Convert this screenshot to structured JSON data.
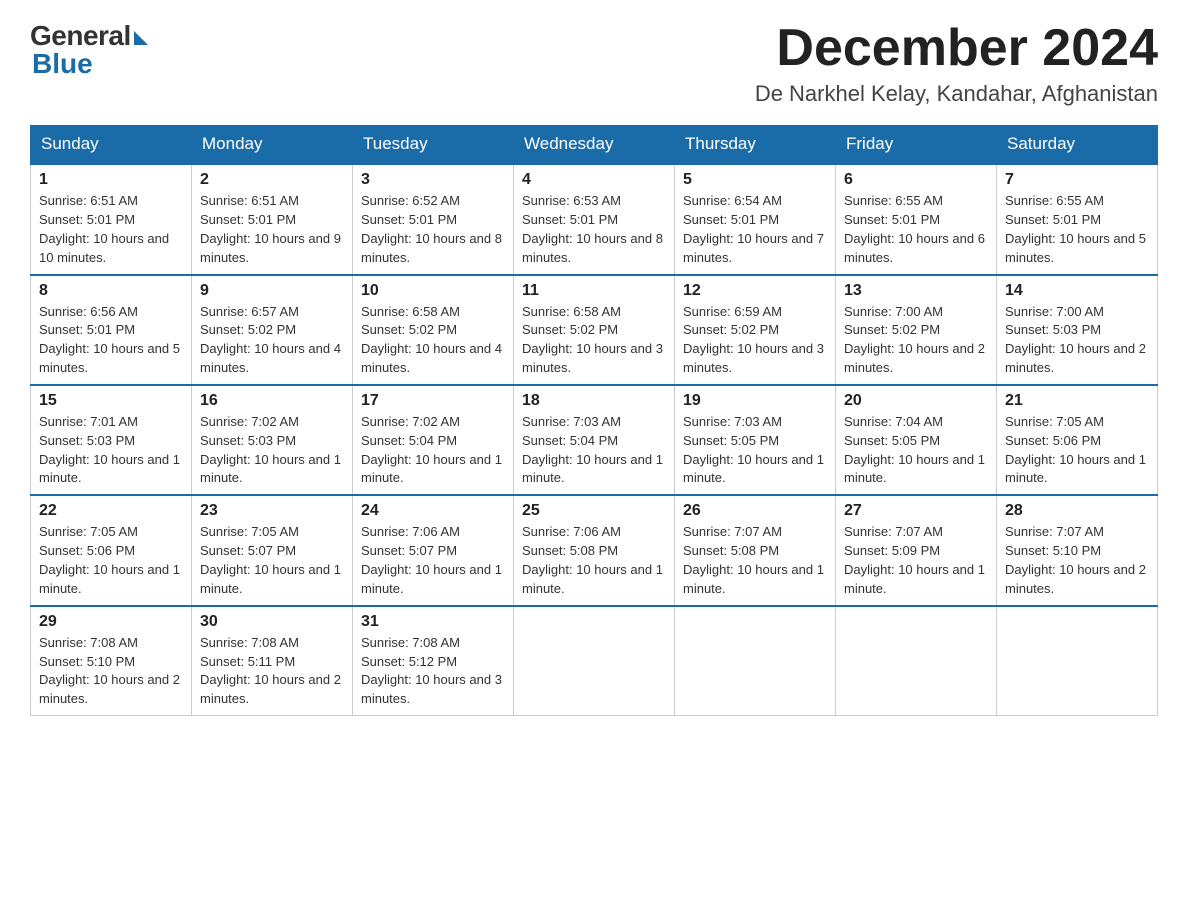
{
  "logo": {
    "general": "General",
    "blue": "Blue"
  },
  "title": "December 2024",
  "location": "De Narkhel Kelay, Kandahar, Afghanistan",
  "days_of_week": [
    "Sunday",
    "Monday",
    "Tuesday",
    "Wednesday",
    "Thursday",
    "Friday",
    "Saturday"
  ],
  "weeks": [
    [
      {
        "day": 1,
        "sunrise": "6:51 AM",
        "sunset": "5:01 PM",
        "daylight": "10 hours and 10 minutes."
      },
      {
        "day": 2,
        "sunrise": "6:51 AM",
        "sunset": "5:01 PM",
        "daylight": "10 hours and 9 minutes."
      },
      {
        "day": 3,
        "sunrise": "6:52 AM",
        "sunset": "5:01 PM",
        "daylight": "10 hours and 8 minutes."
      },
      {
        "day": 4,
        "sunrise": "6:53 AM",
        "sunset": "5:01 PM",
        "daylight": "10 hours and 8 minutes."
      },
      {
        "day": 5,
        "sunrise": "6:54 AM",
        "sunset": "5:01 PM",
        "daylight": "10 hours and 7 minutes."
      },
      {
        "day": 6,
        "sunrise": "6:55 AM",
        "sunset": "5:01 PM",
        "daylight": "10 hours and 6 minutes."
      },
      {
        "day": 7,
        "sunrise": "6:55 AM",
        "sunset": "5:01 PM",
        "daylight": "10 hours and 5 minutes."
      }
    ],
    [
      {
        "day": 8,
        "sunrise": "6:56 AM",
        "sunset": "5:01 PM",
        "daylight": "10 hours and 5 minutes."
      },
      {
        "day": 9,
        "sunrise": "6:57 AM",
        "sunset": "5:02 PM",
        "daylight": "10 hours and 4 minutes."
      },
      {
        "day": 10,
        "sunrise": "6:58 AM",
        "sunset": "5:02 PM",
        "daylight": "10 hours and 4 minutes."
      },
      {
        "day": 11,
        "sunrise": "6:58 AM",
        "sunset": "5:02 PM",
        "daylight": "10 hours and 3 minutes."
      },
      {
        "day": 12,
        "sunrise": "6:59 AM",
        "sunset": "5:02 PM",
        "daylight": "10 hours and 3 minutes."
      },
      {
        "day": 13,
        "sunrise": "7:00 AM",
        "sunset": "5:02 PM",
        "daylight": "10 hours and 2 minutes."
      },
      {
        "day": 14,
        "sunrise": "7:00 AM",
        "sunset": "5:03 PM",
        "daylight": "10 hours and 2 minutes."
      }
    ],
    [
      {
        "day": 15,
        "sunrise": "7:01 AM",
        "sunset": "5:03 PM",
        "daylight": "10 hours and 1 minute."
      },
      {
        "day": 16,
        "sunrise": "7:02 AM",
        "sunset": "5:03 PM",
        "daylight": "10 hours and 1 minute."
      },
      {
        "day": 17,
        "sunrise": "7:02 AM",
        "sunset": "5:04 PM",
        "daylight": "10 hours and 1 minute."
      },
      {
        "day": 18,
        "sunrise": "7:03 AM",
        "sunset": "5:04 PM",
        "daylight": "10 hours and 1 minute."
      },
      {
        "day": 19,
        "sunrise": "7:03 AM",
        "sunset": "5:05 PM",
        "daylight": "10 hours and 1 minute."
      },
      {
        "day": 20,
        "sunrise": "7:04 AM",
        "sunset": "5:05 PM",
        "daylight": "10 hours and 1 minute."
      },
      {
        "day": 21,
        "sunrise": "7:05 AM",
        "sunset": "5:06 PM",
        "daylight": "10 hours and 1 minute."
      }
    ],
    [
      {
        "day": 22,
        "sunrise": "7:05 AM",
        "sunset": "5:06 PM",
        "daylight": "10 hours and 1 minute."
      },
      {
        "day": 23,
        "sunrise": "7:05 AM",
        "sunset": "5:07 PM",
        "daylight": "10 hours and 1 minute."
      },
      {
        "day": 24,
        "sunrise": "7:06 AM",
        "sunset": "5:07 PM",
        "daylight": "10 hours and 1 minute."
      },
      {
        "day": 25,
        "sunrise": "7:06 AM",
        "sunset": "5:08 PM",
        "daylight": "10 hours and 1 minute."
      },
      {
        "day": 26,
        "sunrise": "7:07 AM",
        "sunset": "5:08 PM",
        "daylight": "10 hours and 1 minute."
      },
      {
        "day": 27,
        "sunrise": "7:07 AM",
        "sunset": "5:09 PM",
        "daylight": "10 hours and 1 minute."
      },
      {
        "day": 28,
        "sunrise": "7:07 AM",
        "sunset": "5:10 PM",
        "daylight": "10 hours and 2 minutes."
      }
    ],
    [
      {
        "day": 29,
        "sunrise": "7:08 AM",
        "sunset": "5:10 PM",
        "daylight": "10 hours and 2 minutes."
      },
      {
        "day": 30,
        "sunrise": "7:08 AM",
        "sunset": "5:11 PM",
        "daylight": "10 hours and 2 minutes."
      },
      {
        "day": 31,
        "sunrise": "7:08 AM",
        "sunset": "5:12 PM",
        "daylight": "10 hours and 3 minutes."
      },
      null,
      null,
      null,
      null
    ]
  ]
}
